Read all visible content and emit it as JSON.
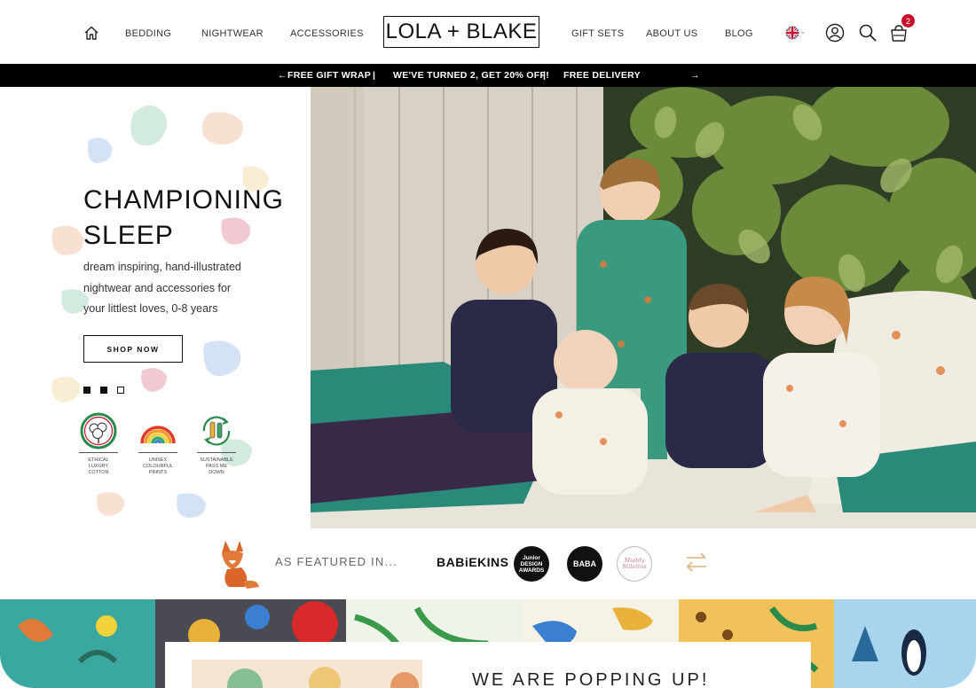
{
  "header": {
    "nav_left": [
      "BEDDING",
      "NIGHTWEAR",
      "ACCESSORIES"
    ],
    "logo": "LOLA + BLAKE",
    "nav_right": [
      "GIFT SETS",
      "ABOUT US",
      "BLOG"
    ],
    "cart_count": "2",
    "icons": [
      "home-icon",
      "uk-flag-icon",
      "account-icon",
      "search-icon",
      "cart-icon"
    ]
  },
  "promo": {
    "items": [
      "FREE GIFT WRAP",
      "|",
      "WE'VE TURNED 2, GET 20% OFF!",
      "|",
      "FREE DELIVERY"
    ],
    "prev_arrow": "←",
    "next_arrow": "→"
  },
  "hero": {
    "title_line1": "CHAMPIONING",
    "title_line2": "SLEEP",
    "sub_line1": "dream inspiring, hand-illustrated",
    "sub_line2": "nightwear and accessories for",
    "sub_line3": "your littlest loves, 0-8 years",
    "cta": "SHOP NOW",
    "slides_total": 3,
    "usps": [
      {
        "icon": "cotton-icon",
        "line1": "ETHICAL",
        "line2": "LUXURY",
        "line3": "COTTON"
      },
      {
        "icon": "rainbow-icon",
        "line1": "UNISEX",
        "line2": "COLOURFUL",
        "line3": "PRINTS"
      },
      {
        "icon": "recycle-icon",
        "line1": "SUSTAINABLE",
        "line2": "PASS ME",
        "line3": "DOWN"
      }
    ]
  },
  "featured": {
    "label": "AS FEATURED IN...",
    "press": [
      "BABiEKINS",
      "Junior DESIGN AWARDS",
      "BABA",
      "Muddy Stilettos"
    ]
  },
  "popup": {
    "title": "WE ARE POPPING UP!"
  },
  "colors": {
    "promo_bg": "#000000",
    "badge": "#c8102e",
    "text": "#111111"
  }
}
